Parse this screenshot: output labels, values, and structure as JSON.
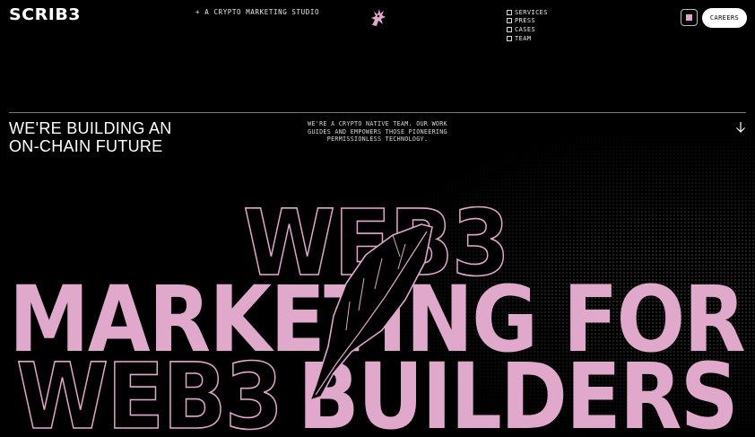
{
  "header": {
    "logo": "SCRIB3",
    "tagline": "+ A CRYPTO MARKETING STUDIO",
    "nav": [
      "SERVICES",
      "PRESS",
      "CASES",
      "TEAM"
    ],
    "careers_label": "CAREERS"
  },
  "intro": {
    "headline_line1": "WE'RE BUILDING AN",
    "headline_line2": "ON-CHAIN FUTURE",
    "blurb_line1": "WE'RE A CRYPTO NATIVE TEAM. OUR WORK",
    "blurb_line2": "GUIDES AND EMPOWERS THOSE PIONEERING",
    "blurb_line3": "PERMISSIONLESS TECHNOLOGY."
  },
  "hero": {
    "line1": "WEB3",
    "line2": "MARKETING FOR",
    "line3a": "WEB3",
    "line3b": "BUILDERS"
  },
  "colors": {
    "background": "#000000",
    "accent": "#e0a8cb",
    "text": "#ffffff"
  },
  "icons": {
    "mascot": "dragon-mascot-icon",
    "menu": "menu-square-icon",
    "scroll": "arrow-down-icon",
    "quill": "quill-feather-icon"
  }
}
